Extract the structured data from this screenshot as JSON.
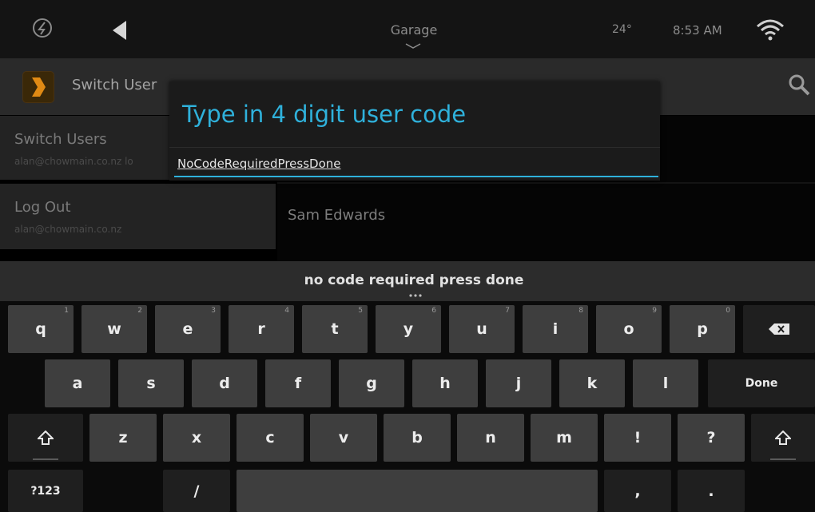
{
  "status_bar": {
    "room": "Garage",
    "temperature": "24°",
    "time": "8:53 AM"
  },
  "action_bar": {
    "title": "Switch User",
    "icons": [
      "app-chevron-icon",
      "search-icon"
    ]
  },
  "menu": {
    "items": [
      {
        "title": "Switch Users",
        "subtitle": "alan@chowmain.co.nz lo"
      },
      {
        "title": "Log Out",
        "subtitle": "alan@chowmain.co.nz"
      }
    ]
  },
  "user_list": {
    "users": [
      "Sam Edwards"
    ]
  },
  "dialog": {
    "title": "Type in 4 digit user code",
    "input_value": "NoCodeRequiredPressDone"
  },
  "keyboard": {
    "suggestion": "no code required press done",
    "row1": [
      {
        "label": "q",
        "hint": "1"
      },
      {
        "label": "w",
        "hint": "2"
      },
      {
        "label": "e",
        "hint": "3"
      },
      {
        "label": "r",
        "hint": "4"
      },
      {
        "label": "t",
        "hint": "5"
      },
      {
        "label": "y",
        "hint": "6"
      },
      {
        "label": "u",
        "hint": "7"
      },
      {
        "label": "i",
        "hint": "8"
      },
      {
        "label": "o",
        "hint": "9"
      },
      {
        "label": "p",
        "hint": "0"
      }
    ],
    "row2": [
      "a",
      "s",
      "d",
      "f",
      "g",
      "h",
      "j",
      "k",
      "l"
    ],
    "row3": [
      "z",
      "x",
      "c",
      "v",
      "b",
      "n",
      "m",
      "!",
      "?"
    ],
    "done_label": "Done",
    "symbols_label": "?123",
    "slash_label": "/",
    "comma_label": ",",
    "period_label": ".",
    "icons": [
      "backspace-icon",
      "shift-icon"
    ]
  },
  "colors": {
    "accent": "#2fb1db",
    "key": "#3e3e3e",
    "key_dark": "#1f1f1f"
  }
}
